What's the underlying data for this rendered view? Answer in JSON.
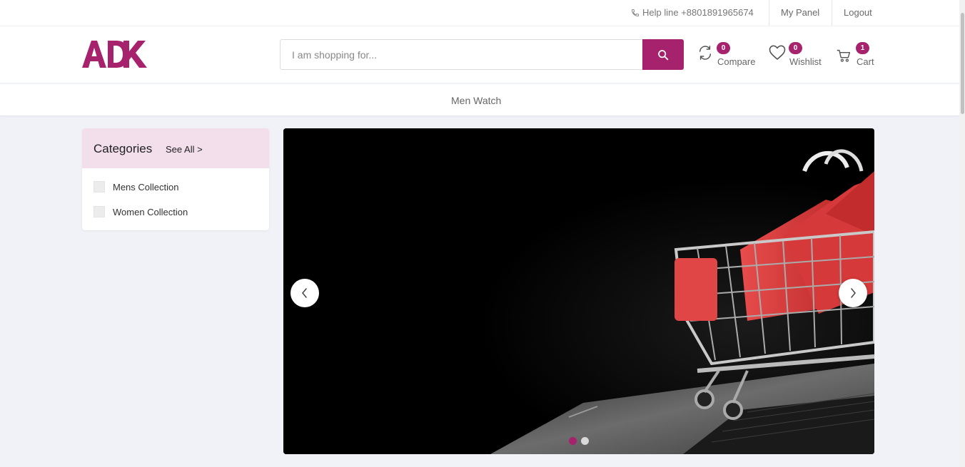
{
  "topbar": {
    "help_line": "Help line +8801891965674",
    "my_panel": "My Panel",
    "logout": "Logout"
  },
  "header": {
    "logo_text": "ADK",
    "search_placeholder": "I am shopping for...",
    "compare": {
      "label": "Compare",
      "count": "0"
    },
    "wishlist": {
      "label": "Wishlist",
      "count": "0"
    },
    "cart": {
      "label": "Cart",
      "count": "1"
    }
  },
  "nav": {
    "items": [
      {
        "label": "Men Watch"
      }
    ]
  },
  "categories": {
    "title": "Categories",
    "see_all": "See All >",
    "items": [
      {
        "label": "Mens Collection"
      },
      {
        "label": "Women Collection"
      }
    ]
  },
  "slider": {
    "active_slide": 1,
    "slide_count": 2
  },
  "colors": {
    "brand": "#a6226d",
    "category_header": "#f2dfeb",
    "page_bg": "#f1f2f7"
  },
  "icons": [
    "phone-icon",
    "search-icon",
    "compare-icon",
    "heart-icon",
    "cart-icon",
    "chevron-left-icon",
    "chevron-right-icon"
  ]
}
